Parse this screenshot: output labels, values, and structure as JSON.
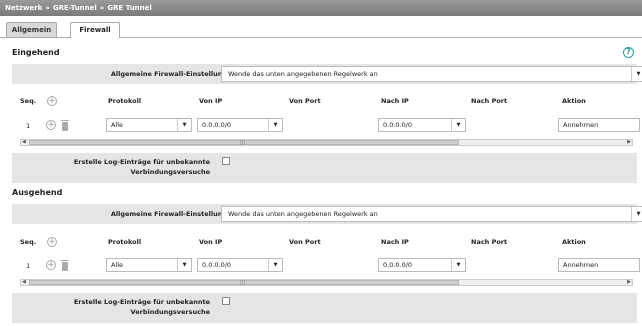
{
  "breadcrumb": {
    "items": [
      "Netzwerk",
      "GRE-Tunnel",
      "GRE Tunnel"
    ],
    "separator": "»"
  },
  "tabs": [
    {
      "label": "Allgemein",
      "active": false
    },
    {
      "label": "Firewall",
      "active": true
    }
  ],
  "help_icon": "question-circle-icon",
  "columns": {
    "seq": "Seq.",
    "protokoll": "Protokoll",
    "von_ip": "Von IP",
    "von_port": "Von Port",
    "nach_ip": "Nach IP",
    "nach_port": "Nach Port",
    "aktion": "Aktion"
  },
  "inbound": {
    "title": "Eingehend",
    "general_label": "Allgemeine Firewall-Einstellung",
    "general_value": "Wende das unten angegebenen Regelwerk an",
    "rows": [
      {
        "seq": "1",
        "protokoll": "Alle",
        "von_ip": "0.0.0.0/0",
        "nach_ip": "0.0.0.0/0",
        "aktion": "Annehmen"
      }
    ],
    "log_label_line1": "Erstelle Log-Einträge für unbekannte",
    "log_label_line2": "Verbindungsversuche",
    "log_checked": false
  },
  "outbound": {
    "title": "Ausgehend",
    "general_label": "Allgemeine Firewall-Einstellung",
    "general_value": "Wende das unten angegebenen Regelwerk an",
    "rows": [
      {
        "seq": "1",
        "protokoll": "Alle",
        "von_ip": "0.0.0.0/0",
        "nach_ip": "0.0.0.0/0",
        "aktion": "Annehmen"
      }
    ],
    "log_label_line1": "Erstelle Log-Einträge für unbekannte",
    "log_label_line2": "Verbindungsversuche",
    "log_checked": false
  },
  "colors": {
    "breadcrumb_bg": "#8a8a8a",
    "section_bg": "#e5e5e5",
    "help": "#2a9a9a"
  }
}
